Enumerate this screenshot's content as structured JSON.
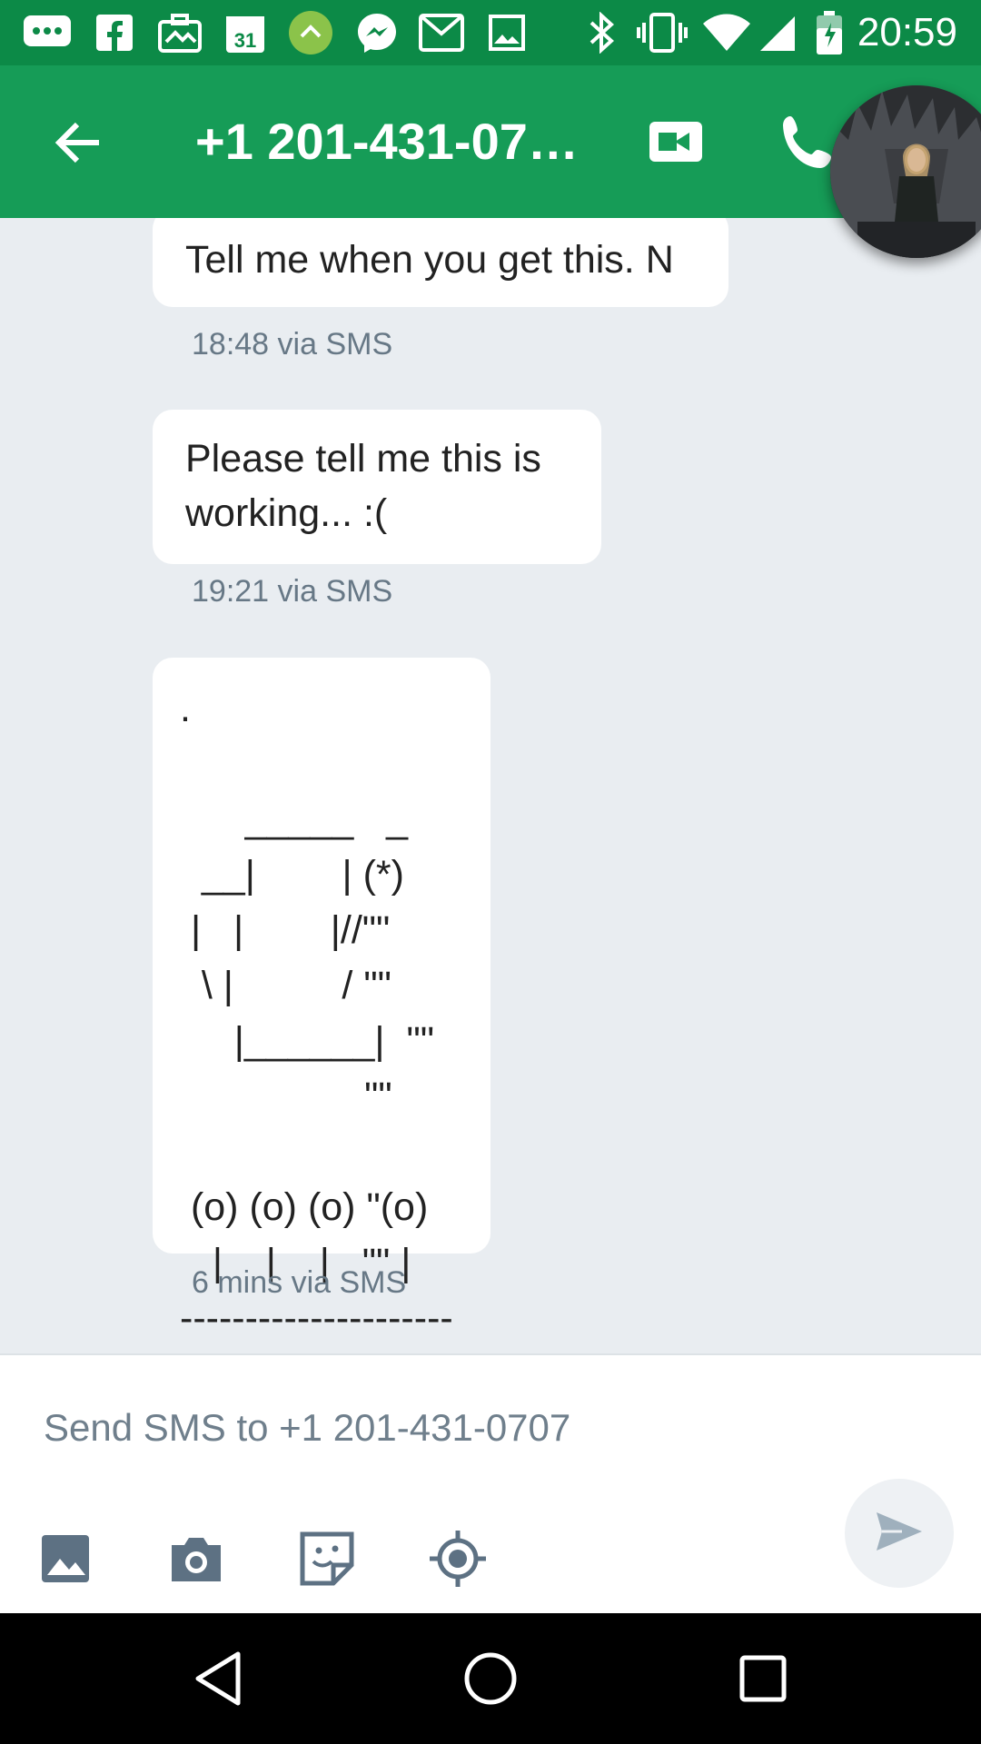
{
  "status_bar": {
    "time": "20:59",
    "left_icons": [
      "messages-icon",
      "facebook-icon",
      "briefcase-icon",
      "calendar-icon",
      "hangouts-bubble-icon",
      "messenger-icon",
      "gmail-icon",
      "image-icon"
    ],
    "right_icons": [
      "bluetooth-icon",
      "vibrate-icon",
      "wifi-icon",
      "signal-icon",
      "battery-icon"
    ],
    "calendar_day": "31"
  },
  "app_bar": {
    "title": "+1 201-431-07…",
    "back_icon": "arrow-back-icon",
    "video_icon": "video-call-icon",
    "call_icon": "phone-icon",
    "background_color": "#169c57",
    "status_color": "#0c8a47"
  },
  "messages": [
    {
      "text": "Tell me when you get this. N",
      "meta": "18:48 via SMS"
    },
    {
      "text": "Please tell me this is working... :(",
      "meta": "19:21 via SMS"
    },
    {
      "text": ".\n\n      _____   _\n  __|        | (*)\n |   |        |//\"\"\n  \\ |          / \"\"\n     |______|  \"\"\n                 \"\"\n\n (o) (o) (o) \"(o)\n   |    |    |   \"\" |\n---------------------",
      "meta": "6 mins via SMS"
    }
  ],
  "compose": {
    "placeholder": "Send SMS to +1 201-431-0707",
    "tools": [
      "gallery-icon",
      "camera-icon",
      "sticker-icon",
      "location-icon"
    ],
    "send_icon": "send-icon"
  },
  "nav_bar": {
    "buttons": [
      "back-triangle-icon",
      "home-circle-icon",
      "recents-square-icon"
    ]
  }
}
